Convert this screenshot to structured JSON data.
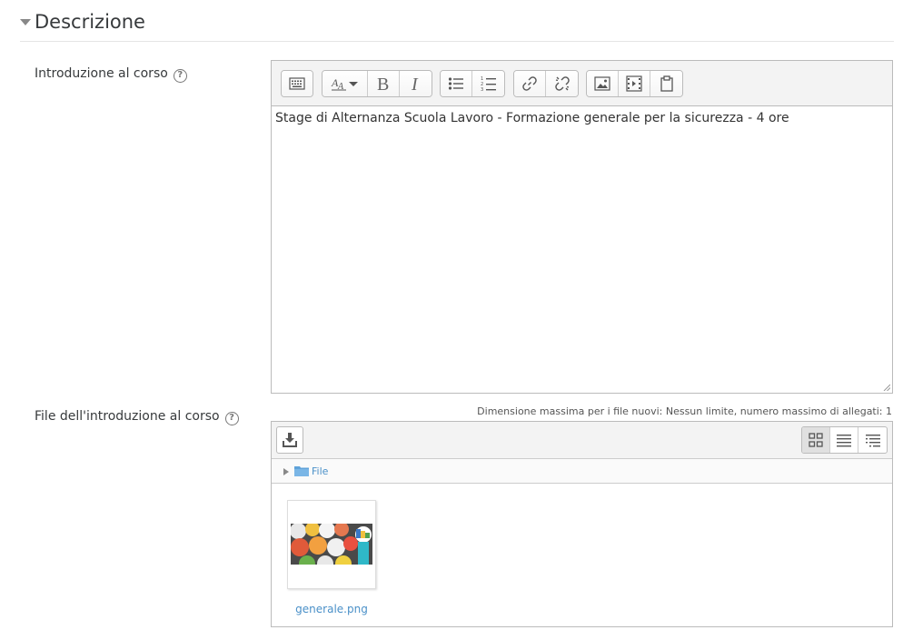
{
  "section": {
    "title": "Descrizione"
  },
  "intro": {
    "label": "Introduzione al corso",
    "content": "Stage di Alternanza Scuola Lavoro - Formazione generale per la sicurezza - 4 ore"
  },
  "files": {
    "label": "File dell'introduzione al corso",
    "max_info": "Dimensione massima per i file nuovi: Nessun limite, numero massimo di allegati: 1",
    "folder": "File",
    "file_name": "generale.png"
  },
  "help_glyph": "?",
  "icons": [
    "toolbar-toggle-icon",
    "style-icon",
    "bold-icon",
    "italic-icon",
    "unordered-list-icon",
    "ordered-list-icon",
    "link-icon",
    "unlink-icon",
    "image-icon",
    "media-icon",
    "paste-icon",
    "add-file-icon",
    "grid-view-icon",
    "list-view-icon",
    "tree-view-icon",
    "folder-icon"
  ]
}
